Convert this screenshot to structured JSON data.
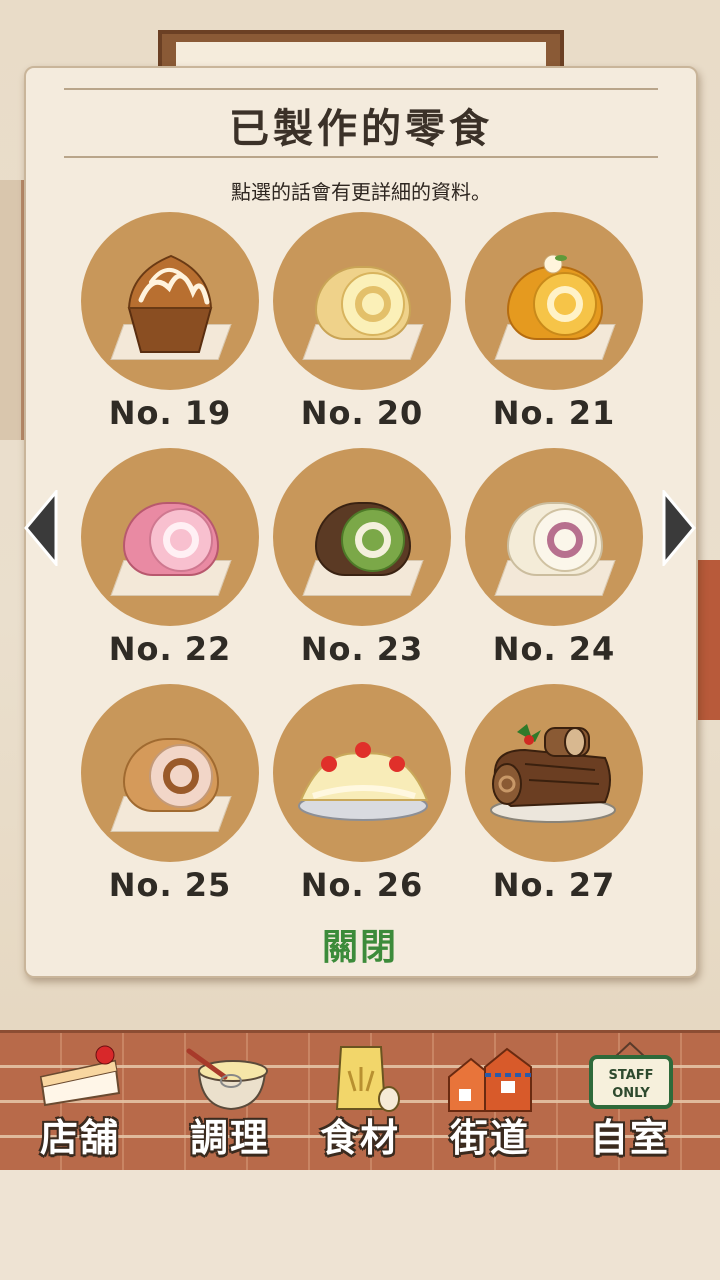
{
  "panel": {
    "title": "已製作的零食",
    "subtitle": "點選的話會有更詳細的資料。",
    "close_label": "關閉"
  },
  "items": [
    {
      "label": "No. 19",
      "icon": "cupcake-icon"
    },
    {
      "label": "No. 20",
      "icon": "custard-roll-cake-icon"
    },
    {
      "label": "No. 21",
      "icon": "pumpkin-roll-cake-icon"
    },
    {
      "label": "No. 22",
      "icon": "strawberry-roll-cake-icon"
    },
    {
      "label": "No. 23",
      "icon": "matcha-roll-cake-icon"
    },
    {
      "label": "No. 24",
      "icon": "berry-roll-cake-icon"
    },
    {
      "label": "No. 25",
      "icon": "chocolate-chip-roll-cake-icon"
    },
    {
      "label": "No. 26",
      "icon": "strawberry-crepe-icon"
    },
    {
      "label": "No. 27",
      "icon": "buche-de-noel-icon"
    }
  ],
  "nav": [
    {
      "label": "店舖",
      "icon": "cake-slice-icon"
    },
    {
      "label": "調理",
      "icon": "mixing-bowl-icon"
    },
    {
      "label": "食材",
      "icon": "flour-bag-icon"
    },
    {
      "label": "街道",
      "icon": "street-houses-icon"
    },
    {
      "label": "自室",
      "icon": "staff-only-sign-icon",
      "sign_text": "STAFF ONLY"
    }
  ],
  "colors": {
    "circle": "#c8975a",
    "panel": "#f4ebdd",
    "close_text": "#3c8b3a"
  }
}
